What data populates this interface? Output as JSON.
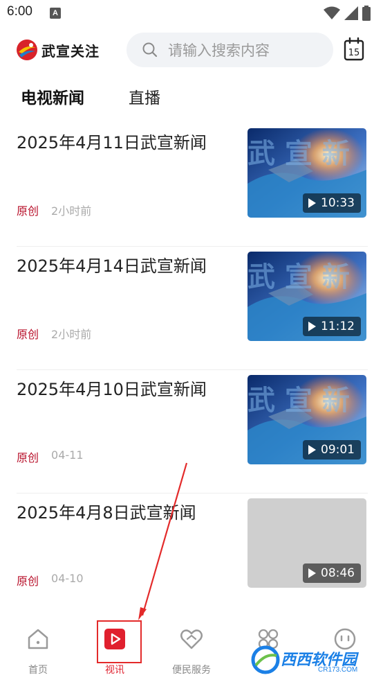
{
  "status_bar": {
    "time": "6:00",
    "notification_letter": "A"
  },
  "header": {
    "app_name": "武宣关注",
    "search_placeholder": "请输入搜索内容",
    "calendar_day": "15"
  },
  "tabs": [
    {
      "label": "电视新闻",
      "active": true
    },
    {
      "label": "直播",
      "active": false
    }
  ],
  "news": [
    {
      "title": "2025年4月11日武宣新闻",
      "tag": "原创",
      "time": "2小时前",
      "duration": "10:33",
      "has_thumbnail": true
    },
    {
      "title": "2025年4月14日武宣新闻",
      "tag": "原创",
      "time": "2小时前",
      "duration": "11:12",
      "has_thumbnail": true
    },
    {
      "title": "2025年4月10日武宣新闻",
      "tag": "原创",
      "time": "04-11",
      "duration": "09:01",
      "has_thumbnail": true
    },
    {
      "title": "2025年4月8日武宣新闻",
      "tag": "原创",
      "time": "04-10",
      "duration": "08:46",
      "has_thumbnail": false
    }
  ],
  "bottom_nav": [
    {
      "label": "首页",
      "icon": "home-icon",
      "active": false
    },
    {
      "label": "视讯",
      "icon": "video-icon",
      "active": true
    },
    {
      "label": "便民服务",
      "icon": "heart-service-icon",
      "active": false
    },
    {
      "label": "",
      "icon": "apps-icon",
      "active": false
    },
    {
      "label": "",
      "icon": "profile-face-icon",
      "active": false
    }
  ],
  "watermark": {
    "text": "西西软件园",
    "sub": "CR173.COM"
  },
  "colors": {
    "accent": "#e0202e",
    "tag_red": "#b8102a",
    "search_bg": "#f1f3f6"
  }
}
